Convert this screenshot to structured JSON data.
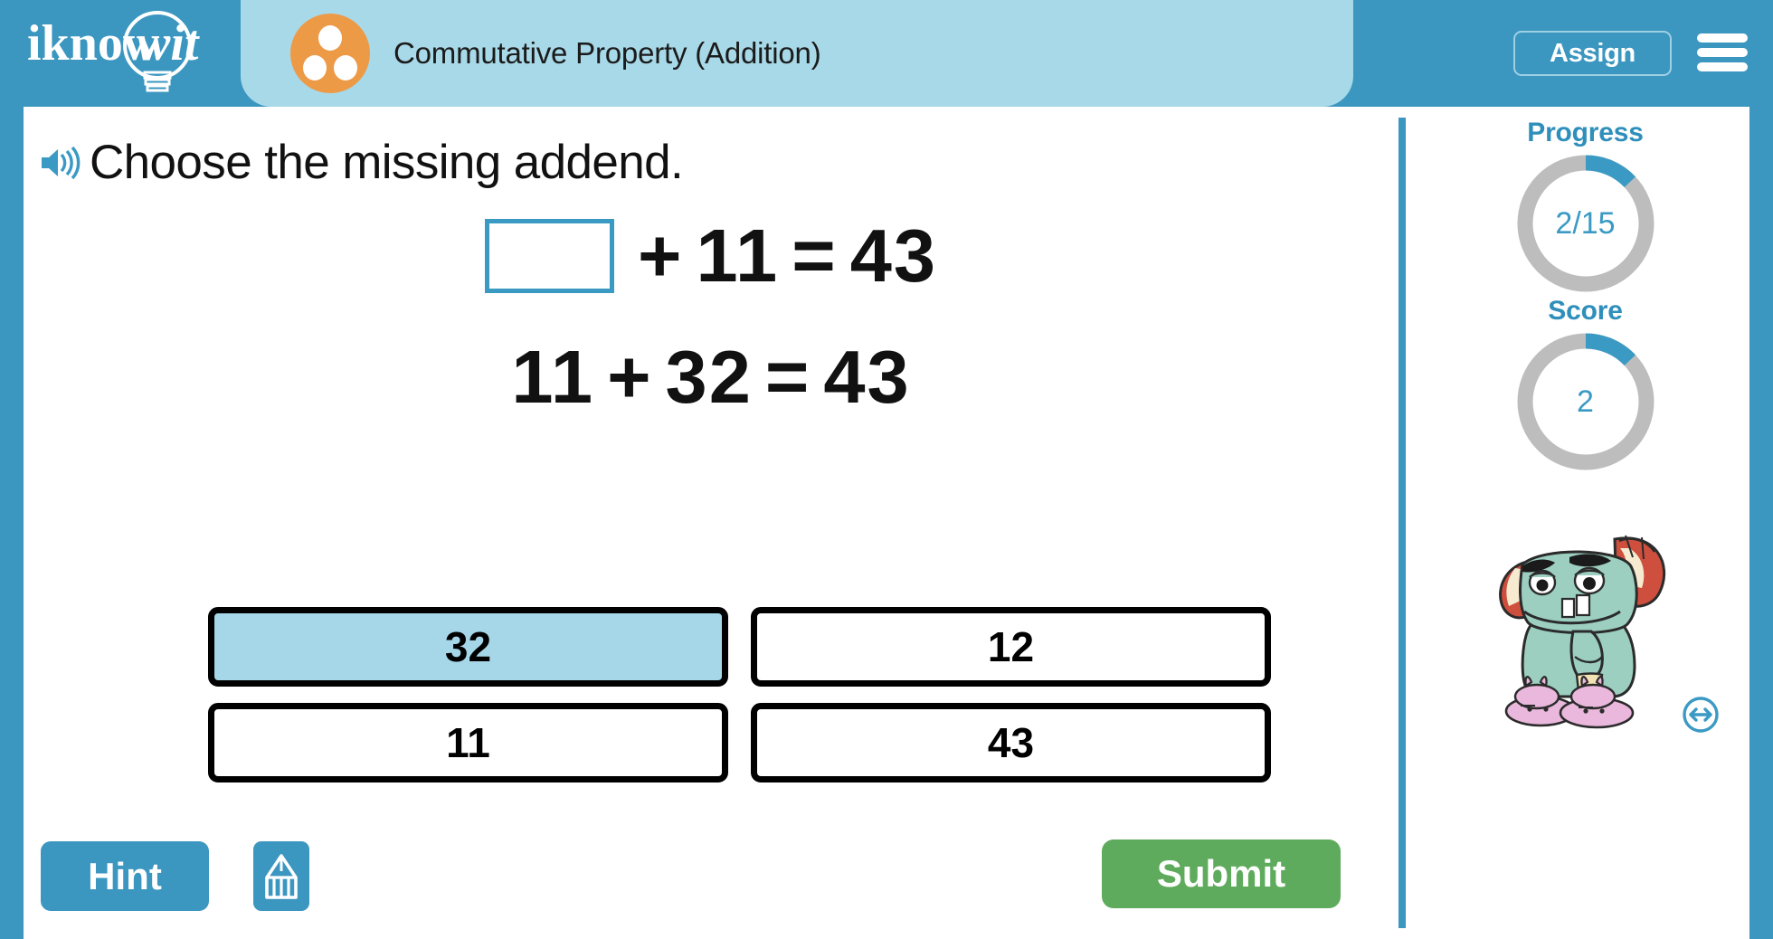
{
  "header": {
    "logo_text": "iknowit",
    "logo_icon": "lightbulb-icon",
    "topic_icon": "three-dots-circle-icon",
    "title": "Commutative Property (Addition)",
    "assign_label": "Assign",
    "menu_icon": "hamburger-menu-icon",
    "brand_blue": "#3b96c0",
    "pill_blue": "#a8d9e8",
    "topic_icon_orange": "#ed9a47"
  },
  "question": {
    "speaker_icon": "speaker-audio-icon",
    "prompt": "Choose the missing addend."
  },
  "equations": [
    {
      "has_blank": true,
      "blank_value": "",
      "addend2": "11",
      "operator": "+",
      "equals": "=",
      "sum": "43"
    },
    {
      "has_blank": false,
      "addend1": "11",
      "addend2": "32",
      "operator": "+",
      "equals": "=",
      "sum": "43"
    }
  ],
  "answers": [
    {
      "label": "32",
      "selected": true
    },
    {
      "label": "12",
      "selected": false
    },
    {
      "label": "11",
      "selected": false
    },
    {
      "label": "43",
      "selected": false
    }
  ],
  "footer": {
    "hint_label": "Hint",
    "scratchpad_icon": "pencil-scratchpad-icon",
    "submit_label": "Submit",
    "submit_green": "#5fab5d"
  },
  "sidebar": {
    "progress": {
      "label": "Progress",
      "value": "2/15",
      "current": 2,
      "total": 15,
      "percent": 13
    },
    "score": {
      "label": "Score",
      "value": "2",
      "current": 2,
      "total": 15,
      "percent": 13
    },
    "mascot_name": "monster-mascot",
    "resize_icon": "resize-horizontal-icon",
    "accent": "#3b9ac4",
    "track": "#bdbdbd"
  }
}
